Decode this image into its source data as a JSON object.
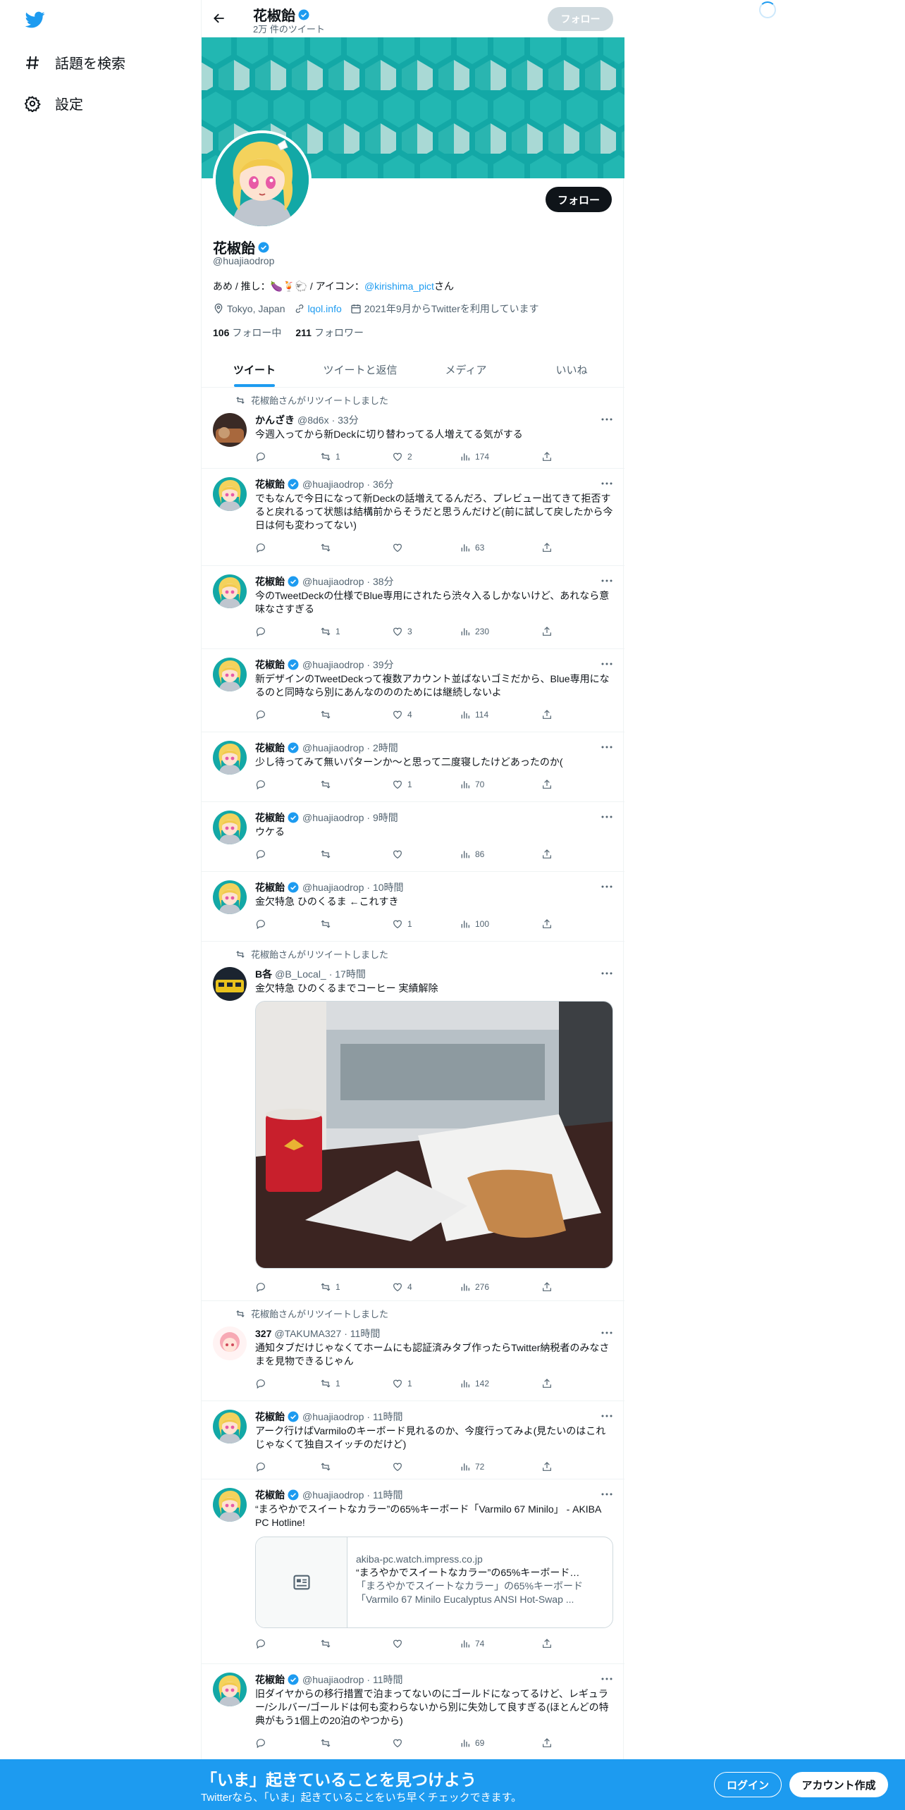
{
  "nav": {
    "items": [
      {
        "label": "話題を検索",
        "icon": "hashtag-icon"
      },
      {
        "label": "設定",
        "icon": "gear-icon"
      }
    ]
  },
  "header": {
    "name": "花椒飴",
    "tweet_count": "2万 件のツイート",
    "follow_label": "フォロー"
  },
  "profile": {
    "name": "花椒飴",
    "handle": "@huajiaodrop",
    "follow_label": "フォロー",
    "bio_prefix": "あめ / 推し：🍆🍹🐑 / アイコン：",
    "bio_link": "@kirishima_pict",
    "bio_suffix": "さん",
    "location": "Tokyo, Japan",
    "website": "lqol.info",
    "joined": "2021年9月からTwitterを利用しています",
    "following_count": "106",
    "following_label": "フォロー中",
    "followers_count": "211",
    "followers_label": "フォロワー"
  },
  "tabs": [
    "ツイート",
    "ツイートと返信",
    "メディア",
    "いいね"
  ],
  "tweets": [
    {
      "retweeted_by": "花椒飴さんがリツイートしました",
      "name": "かんざき",
      "handle": "@8d6x",
      "time": "· 33分",
      "text": "今週入ってから新Deckに切り替わってる人増えてる気がする",
      "retweets": "1",
      "likes": "2",
      "views": "174"
    },
    {
      "name": "花椒飴",
      "handle": "@huajiaodrop",
      "time": "· 36分",
      "text": "でもなんで今日になって新Deckの話増えてるんだろ、プレビュー出てきて拒否すると戻れるって状態は結構前からそうだと思うんだけど(前に試して戻したから今日は何も変わってない)",
      "retweets": "",
      "likes": "",
      "views": "63"
    },
    {
      "name": "花椒飴",
      "handle": "@huajiaodrop",
      "time": "· 38分",
      "text": "今のTweetDeckの仕様でBlue専用にされたら渋々入るしかないけど、あれなら意味なさすぎる",
      "retweets": "1",
      "likes": "3",
      "views": "230"
    },
    {
      "name": "花椒飴",
      "handle": "@huajiaodrop",
      "time": "· 39分",
      "text": "新デザインのTweetDeckって複数アカウント並ばないゴミだから、Blue専用になるのと同時なら別にあんなのののためには継続しないよ",
      "retweets": "",
      "likes": "4",
      "views": "114"
    },
    {
      "name": "花椒飴",
      "handle": "@huajiaodrop",
      "time": "· 2時間",
      "text": "少し待ってみて無いパターンか～と思って二度寝したけどあったのか(",
      "retweets": "",
      "likes": "1",
      "views": "70"
    },
    {
      "name": "花椒飴",
      "handle": "@huajiaodrop",
      "time": "· 9時間",
      "text": "ウケる",
      "retweets": "",
      "likes": "",
      "views": "86"
    },
    {
      "name": "花椒飴",
      "handle": "@huajiaodrop",
      "time": "· 10時間",
      "text": "金欠特急 ひのくるま ←これすき",
      "retweets": "",
      "likes": "1",
      "views": "100"
    },
    {
      "retweeted_by": "花椒飴さんがリツイートしました",
      "name": "B各",
      "handle": "@B_Local_",
      "time": "· 17時間",
      "text": "金欠特急 ひのくるまでコーヒー 実績解除",
      "retweets": "1",
      "likes": "4",
      "views": "276"
    },
    {
      "retweeted_by": "花椒飴さんがリツイートしました",
      "name": "327",
      "handle": "@TAKUMA327",
      "time": "· 11時間",
      "text": "通知タブだけじゃなくてホームにも認証済みタブ作ったらTwitter納税者のみなさまを見物できるじゃん",
      "retweets": "1",
      "likes": "1",
      "views": "142"
    },
    {
      "name": "花椒飴",
      "handle": "@huajiaodrop",
      "time": "· 11時間",
      "text": "アーク行けばVarmiloのキーボード見れるのか、今度行ってみよ(見たいのはこれじゃなくて独自スイッチのだけど)",
      "retweets": "",
      "likes": "",
      "views": "72"
    },
    {
      "name": "花椒飴",
      "handle": "@huajiaodrop",
      "time": "· 11時間",
      "text": "“まろやかでスイートなカラー”の65%キーボード「Varmilo 67 Minilo」 - AKIBA PC Hotline!",
      "retweets": "",
      "likes": "",
      "views": "74",
      "card": {
        "domain": "akiba-pc.watch.impress.co.jp",
        "title": "“まろやかでスイートなカラー”の65%キーボード…",
        "desc": "「まろやかでスイートなカラー」の65%キーボード「Varmilo 67 Minilo Eucalyptus ANSI Hot-Swap ..."
      }
    },
    {
      "name": "花椒飴",
      "handle": "@huajiaodrop",
      "time": "· 11時間",
      "text": "旧ダイヤからの移行措置で泊まってないのにゴールドになってるけど、レギュラー/シルバー/ゴールドは何も変わらないから別に失効して良すぎる(ほとんどの特典がもう1個上の20泊のやつから)",
      "retweets": "",
      "likes": "",
      "views": "69"
    }
  ],
  "bottom_bar": {
    "title": "「いま」起きていることを見つけよう",
    "subtitle": "Twitterなら、「いま」起きていることをいち早くチェックできます。",
    "login_label": "ログイン",
    "signup_label": "アカウント作成"
  },
  "colors": {
    "accent": "#1d9bf0",
    "banner_teal": "#13a8a6",
    "banner_light": "#a9d9d5"
  }
}
